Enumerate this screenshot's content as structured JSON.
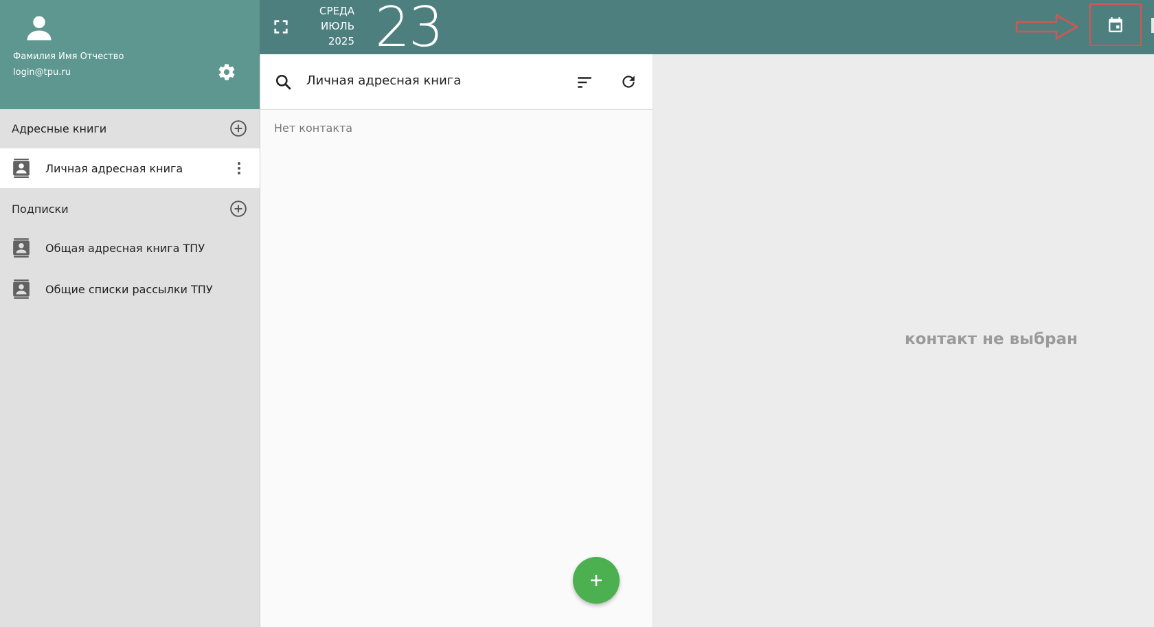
{
  "user": {
    "full_name": "Фамилия Имя Отчество",
    "login": "login@tpu.ru"
  },
  "sidebar": {
    "address_books_title": "Адресные книги",
    "address_books": [
      {
        "label": "Личная адресная книга",
        "active": true
      }
    ],
    "subscriptions_title": "Подписки",
    "subscriptions": [
      {
        "label": "Общая адресная книга ТПУ"
      },
      {
        "label": "Общие списки рассылки ТПУ"
      }
    ]
  },
  "date": {
    "weekday": "СРЕДА",
    "month": "ИЮЛЬ",
    "year": "2025",
    "day": "23"
  },
  "list": {
    "title": "Личная адресная книга",
    "empty_text": "Нет контакта",
    "fab_label": "+"
  },
  "detail": {
    "empty_text": "контакт не выбран"
  },
  "colors": {
    "header": "#4e7f7f",
    "profile": "#5e9790",
    "fab": "#4caf50",
    "highlight": "#d9534f"
  }
}
